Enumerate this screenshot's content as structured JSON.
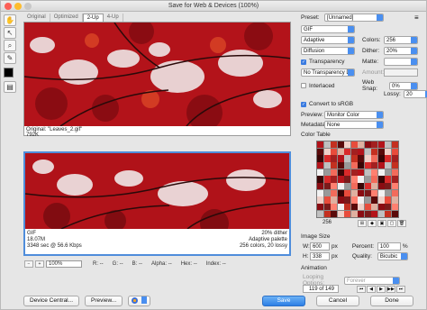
{
  "window": {
    "title": "Save for Web & Devices (100%)"
  },
  "tabs": [
    "Original",
    "Optimized",
    "2-Up",
    "4-Up"
  ],
  "active_tab": 2,
  "original_panel": {
    "name": "Original: \"Leaves_2.gif\"",
    "size": "792K"
  },
  "optimized_panel": {
    "format": "GIF",
    "size": "18.07M",
    "time": "3348 sec @ 56.6 Kbps",
    "dither": "20% dither",
    "palette": "Adaptive palette",
    "colors": "256 colors, 20 lossy"
  },
  "statusbar": {
    "zoom": "100%",
    "r": "R: --",
    "g": "G: --",
    "b": "B: --",
    "alpha": "Alpha: --",
    "hex": "Hex: --",
    "index": "Index: --"
  },
  "buttons": {
    "device_central": "Device Central...",
    "preview": "Preview...",
    "save": "Save",
    "cancel": "Cancel",
    "done": "Done"
  },
  "settings": {
    "preset_label": "Preset:",
    "preset_value": "[Unnamed]",
    "format": "GIF",
    "reduction": "Adaptive",
    "colors_label": "Colors:",
    "colors_value": "256",
    "dither_algo": "Diffusion",
    "dither_label": "Dither:",
    "dither_value": "20%",
    "transparency_label": "Transparency",
    "matte_label": "Matte:",
    "trans_dither": "No Transparency Dither",
    "amount_label": "Amount:",
    "interlaced_label": "Interlaced",
    "websnap_label": "Web Snap:",
    "websnap_value": "0%",
    "lossy_label": "Lossy:",
    "lossy_value": "20",
    "convert_label": "Convert to sRGB",
    "preview_label": "Preview:",
    "preview_value": "Monitor Color",
    "metadata_label": "Metadata:",
    "metadata_value": "None"
  },
  "color_table": {
    "title": "Color Table",
    "count": "256"
  },
  "image_size": {
    "title": "Image Size",
    "w_label": "W:",
    "w_value": "600",
    "h_label": "H:",
    "h_value": "338",
    "px": "px",
    "percent_label": "Percent:",
    "percent_value": "100",
    "pct": "%",
    "quality_label": "Quality:",
    "quality_value": "Bicubic"
  },
  "animation": {
    "title": "Animation",
    "looping_label": "Looping Options:",
    "looping_value": "Forever",
    "frame": "119 of 149"
  },
  "colors": {
    "accent": "#3a7be0",
    "focus": "#4f8ddb"
  }
}
